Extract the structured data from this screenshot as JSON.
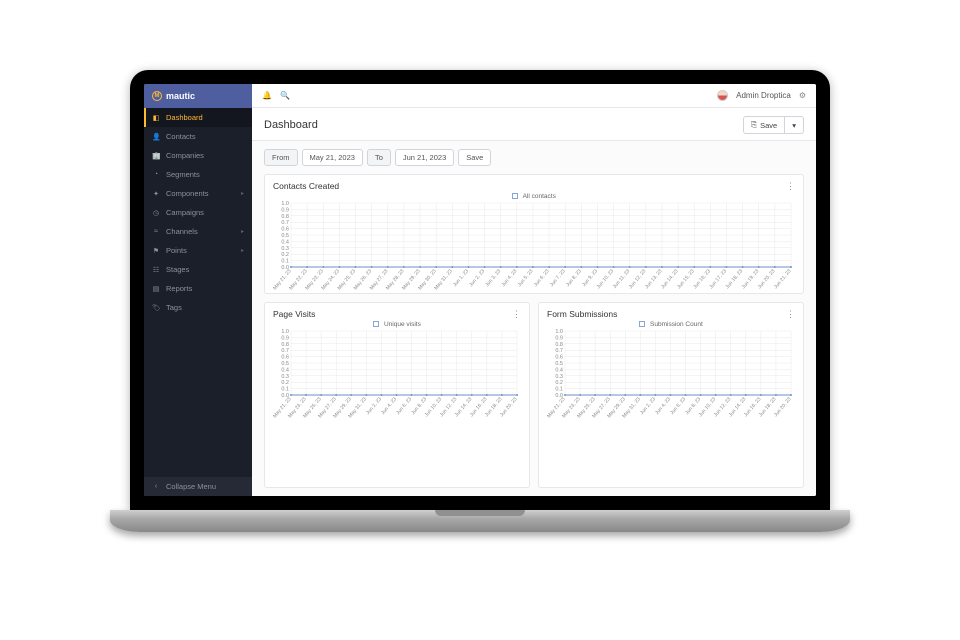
{
  "brand": {
    "name": "mautic"
  },
  "user": {
    "name": "Admin Droptica"
  },
  "sidebar": {
    "items": [
      {
        "label": "Dashboard",
        "icon": "◧",
        "active": true,
        "expandable": false
      },
      {
        "label": "Contacts",
        "icon": "👤",
        "active": false,
        "expandable": false
      },
      {
        "label": "Companies",
        "icon": "🏢",
        "active": false,
        "expandable": false
      },
      {
        "label": "Segments",
        "icon": "◔",
        "active": false,
        "expandable": false
      },
      {
        "label": "Components",
        "icon": "✦",
        "active": false,
        "expandable": true
      },
      {
        "label": "Campaigns",
        "icon": "◷",
        "active": false,
        "expandable": false
      },
      {
        "label": "Channels",
        "icon": "≈",
        "active": false,
        "expandable": true
      },
      {
        "label": "Points",
        "icon": "⚑",
        "active": false,
        "expandable": true
      },
      {
        "label": "Stages",
        "icon": "☷",
        "active": false,
        "expandable": false
      },
      {
        "label": "Reports",
        "icon": "▤",
        "active": false,
        "expandable": false
      },
      {
        "label": "Tags",
        "icon": "🏷",
        "active": false,
        "expandable": false
      }
    ],
    "collapse_label": "Collapse Menu"
  },
  "header": {
    "title": "Dashboard",
    "save_label": "Save"
  },
  "date_filter": {
    "from_label": "From",
    "from_value": "May 21, 2023",
    "to_label": "To",
    "to_value": "Jun 21, 2023",
    "save_label": "Save"
  },
  "chart_data": [
    {
      "id": "contacts_created",
      "type": "line",
      "title": "Contacts Created",
      "legend": "All contacts",
      "ylim": [
        0,
        1.0
      ],
      "yticks": [
        0,
        0.1,
        0.2,
        0.3,
        0.4,
        0.5,
        0.6,
        0.7,
        0.8,
        0.9,
        1.0
      ],
      "categories": [
        "May 21, 23",
        "May 22, 23",
        "May 23, 23",
        "May 24, 23",
        "May 25, 23",
        "May 26, 23",
        "May 27, 23",
        "May 28, 23",
        "May 29, 23",
        "May 30, 23",
        "May 31, 23",
        "Jun 1, 23",
        "Jun 2, 23",
        "Jun 3, 23",
        "Jun 4, 23",
        "Jun 5, 23",
        "Jun 6, 23",
        "Jun 7, 23",
        "Jun 8, 23",
        "Jun 9, 23",
        "Jun 10, 23",
        "Jun 11, 23",
        "Jun 12, 23",
        "Jun 13, 23",
        "Jun 14, 23",
        "Jun 15, 23",
        "Jun 16, 23",
        "Jun 17, 23",
        "Jun 18, 23",
        "Jun 19, 23",
        "Jun 20, 23",
        "Jun 21, 23"
      ],
      "values": [
        0,
        0,
        0,
        0,
        0,
        0,
        0,
        0,
        0,
        0,
        0,
        0,
        0,
        0,
        0,
        0,
        0,
        0,
        0,
        0,
        0,
        0,
        0,
        0,
        0,
        0,
        0,
        0,
        0,
        0,
        0,
        0
      ]
    },
    {
      "id": "page_visits",
      "type": "line",
      "title": "Page Visits",
      "legend": "Unique visits",
      "ylim": [
        0,
        1.0
      ],
      "yticks": [
        0,
        0.1,
        0.2,
        0.3,
        0.4,
        0.5,
        0.6,
        0.7,
        0.8,
        0.9,
        1.0
      ],
      "categories": [
        "May 21, 23",
        "May 23, 23",
        "May 25, 23",
        "May 27, 23",
        "May 29, 23",
        "May 31, 23",
        "Jun 2, 23",
        "Jun 4, 23",
        "Jun 6, 23",
        "Jun 8, 23",
        "Jun 10, 23",
        "Jun 12, 23",
        "Jun 14, 23",
        "Jun 16, 23",
        "Jun 18, 23",
        "Jun 20, 23"
      ],
      "values": [
        0,
        0,
        0,
        0,
        0,
        0,
        0,
        0,
        0,
        0,
        0,
        0,
        0,
        0,
        0,
        0
      ]
    },
    {
      "id": "form_submissions",
      "type": "line",
      "title": "Form Submissions",
      "legend": "Submission Count",
      "ylim": [
        0,
        1.0
      ],
      "yticks": [
        0,
        0.1,
        0.2,
        0.3,
        0.4,
        0.5,
        0.6,
        0.7,
        0.8,
        0.9,
        1.0
      ],
      "categories": [
        "May 21, 23",
        "May 23, 23",
        "May 25, 23",
        "May 27, 23",
        "May 29, 23",
        "May 31, 23",
        "Jun 2, 23",
        "Jun 4, 23",
        "Jun 6, 23",
        "Jun 8, 23",
        "Jun 10, 23",
        "Jun 12, 23",
        "Jun 14, 23",
        "Jun 16, 23",
        "Jun 18, 23",
        "Jun 20, 23"
      ],
      "values": [
        0,
        0,
        0,
        0,
        0,
        0,
        0,
        0,
        0,
        0,
        0,
        0,
        0,
        0,
        0,
        0
      ]
    }
  ]
}
